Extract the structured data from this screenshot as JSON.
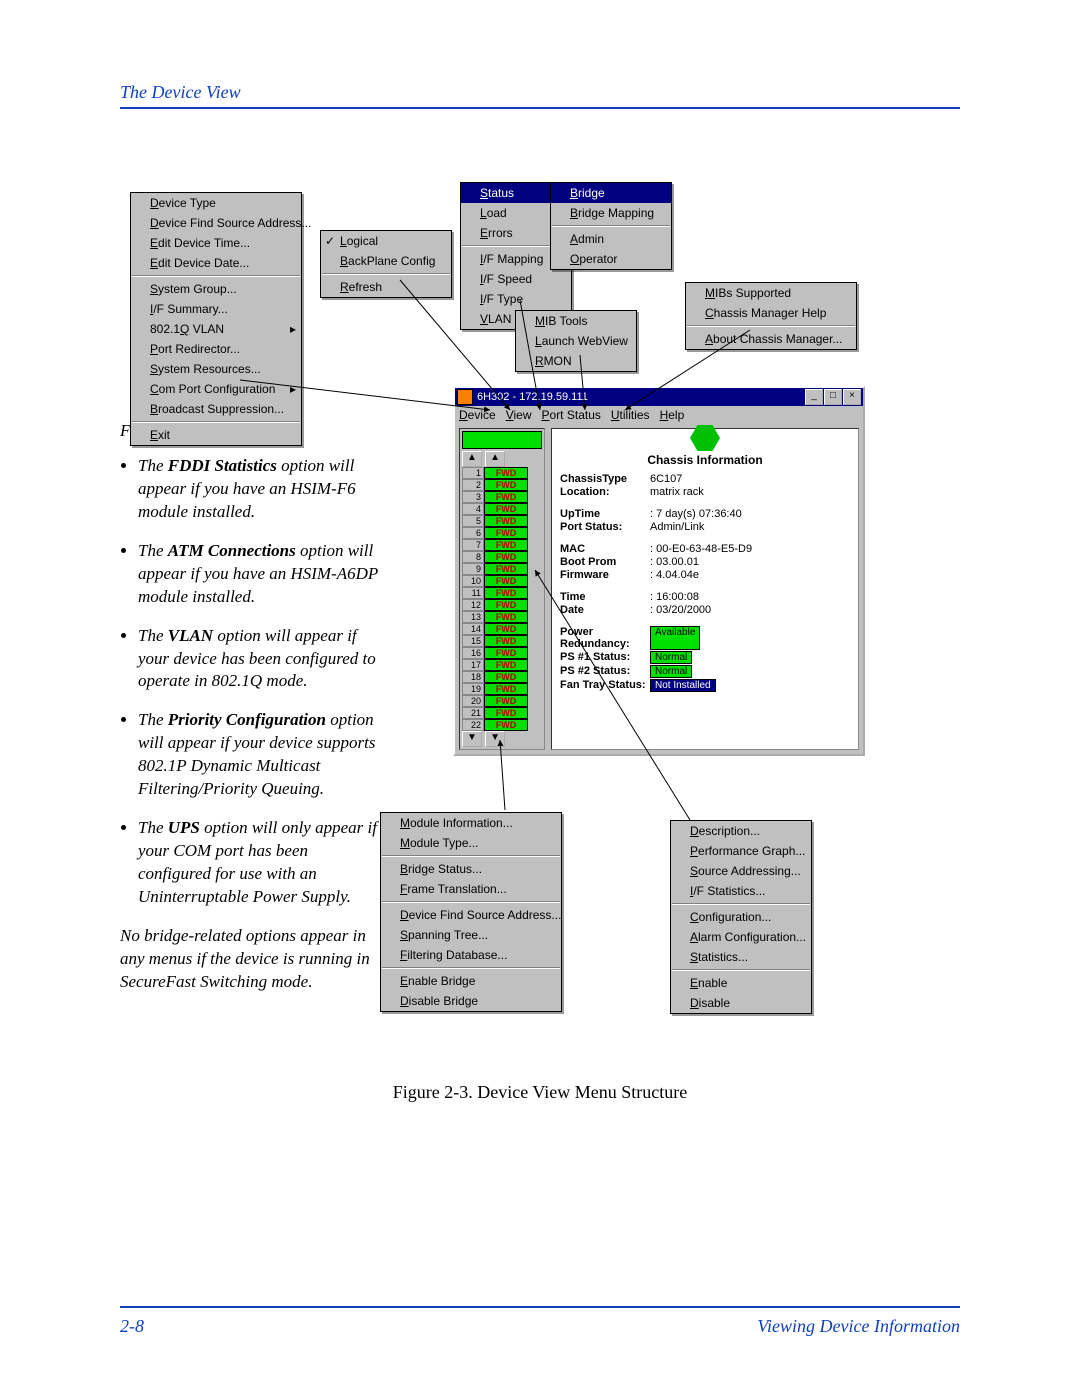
{
  "header": {
    "title": "The Device View"
  },
  "footer": {
    "page": "2-8",
    "section": "Viewing Device Information"
  },
  "figure_caption": "Figure 2-3. Device View Menu Structure",
  "left_text": {
    "intro": "For the Device menu:",
    "bullets": [
      {
        "bold": "FDDI Statistics",
        "text_before": "The ",
        "text_after": " option will appear if you have an HSIM-F6 module installed."
      },
      {
        "bold": "ATM Connections",
        "text_before": "The ",
        "text_after": " option will appear if you have an HSIM-A6DP module installed."
      },
      {
        "bold": "VLAN",
        "text_before": "The ",
        "text_after": " option will appear if your device has been configured to operate in 802.1Q mode."
      },
      {
        "bold": "Priority Configuration",
        "text_before": "The ",
        "text_after": " option will appear if your device supports 802.1P Dynamic Multicast Filtering/Priority Queuing."
      },
      {
        "bold": "UPS",
        "text_before": "The ",
        "text_after": " option will only appear if your COM port has been configured for use with an Uninterruptable Power Supply."
      }
    ],
    "after": "No bridge-related options appear in any menus if the device is running in SecureFast Switching mode."
  },
  "menus": {
    "device": {
      "items": [
        "Device Type",
        "Device Find Source Address...",
        "Edit Device Time...",
        "Edit Device Date...",
        "-",
        "System Group...",
        "I/F Summary...",
        "802.1Q VLAN",
        "Port Redirector...",
        "System Resources...",
        "Com Port Configuration",
        "Broadcast Suppression...",
        "-",
        "Exit"
      ],
      "submenu_at": [
        7,
        10
      ]
    },
    "view": {
      "items": [
        "Logical",
        "BackPlane Config",
        "-",
        "Refresh"
      ],
      "checked": [
        0
      ]
    },
    "portstatus": {
      "items": [
        "Status",
        "Load",
        "Errors",
        "-",
        "I/F Mapping",
        "I/F Speed",
        "I/F Type",
        "VLAN Mapping"
      ],
      "submenu_at": [
        0
      ],
      "highlight": 0
    },
    "bridge": {
      "items": [
        "Bridge",
        "Bridge Mapping",
        "-",
        "Admin",
        "Operator"
      ],
      "highlight": 0
    },
    "util": {
      "items": [
        "MIB Tools",
        "Launch WebView",
        "RMON"
      ]
    },
    "help": {
      "items": [
        "MIBs Supported",
        "Chassis Manager Help",
        "-",
        "About Chassis Manager..."
      ]
    },
    "module": {
      "items": [
        "Module Information...",
        "Module Type...",
        "-",
        "Bridge Status...",
        "Frame Translation...",
        "-",
        "Device Find Source Address...",
        "Spanning Tree...",
        "Filtering Database...",
        "-",
        "Enable Bridge",
        "Disable Bridge"
      ]
    },
    "port": {
      "items": [
        "Description...",
        "Performance Graph...",
        "Source Addressing...",
        "I/F Statistics...",
        "-",
        "Configuration...",
        "Alarm Configuration...",
        "Statistics...",
        "-",
        "Enable",
        "Disable"
      ]
    }
  },
  "app": {
    "title": "6H302 - 172.19.59.111",
    "menubar": [
      "Device",
      "View",
      "Port Status",
      "Utilities",
      "Help"
    ],
    "ports": {
      "count": 22,
      "label": "FWD"
    },
    "info": {
      "heading": "Chassis Information",
      "rows": [
        {
          "k": "ChassisType",
          "v": "6C107"
        },
        {
          "k": "Location:",
          "v": "matrix rack"
        },
        {
          "sp": true
        },
        {
          "k": "UpTime",
          "v": ": 7 day(s) 07:36:40"
        },
        {
          "k": "Port Status:",
          "v": "Admin/Link"
        },
        {
          "sp": true
        },
        {
          "k": "MAC",
          "v": ": 00-E0-63-48-E5-D9"
        },
        {
          "k": "Boot Prom",
          "v": ": 03.00.01"
        },
        {
          "k": "Firmware",
          "v": ": 4.04.04e"
        },
        {
          "sp": true
        },
        {
          "k": "Time",
          "v": ": 16:00:08"
        },
        {
          "k": "Date",
          "v": ": 03/20/2000"
        },
        {
          "sp": true
        }
      ],
      "power_redundancy": "Available",
      "ps1": "Normal",
      "ps2": "Normal",
      "fan": "Not Installed"
    }
  }
}
